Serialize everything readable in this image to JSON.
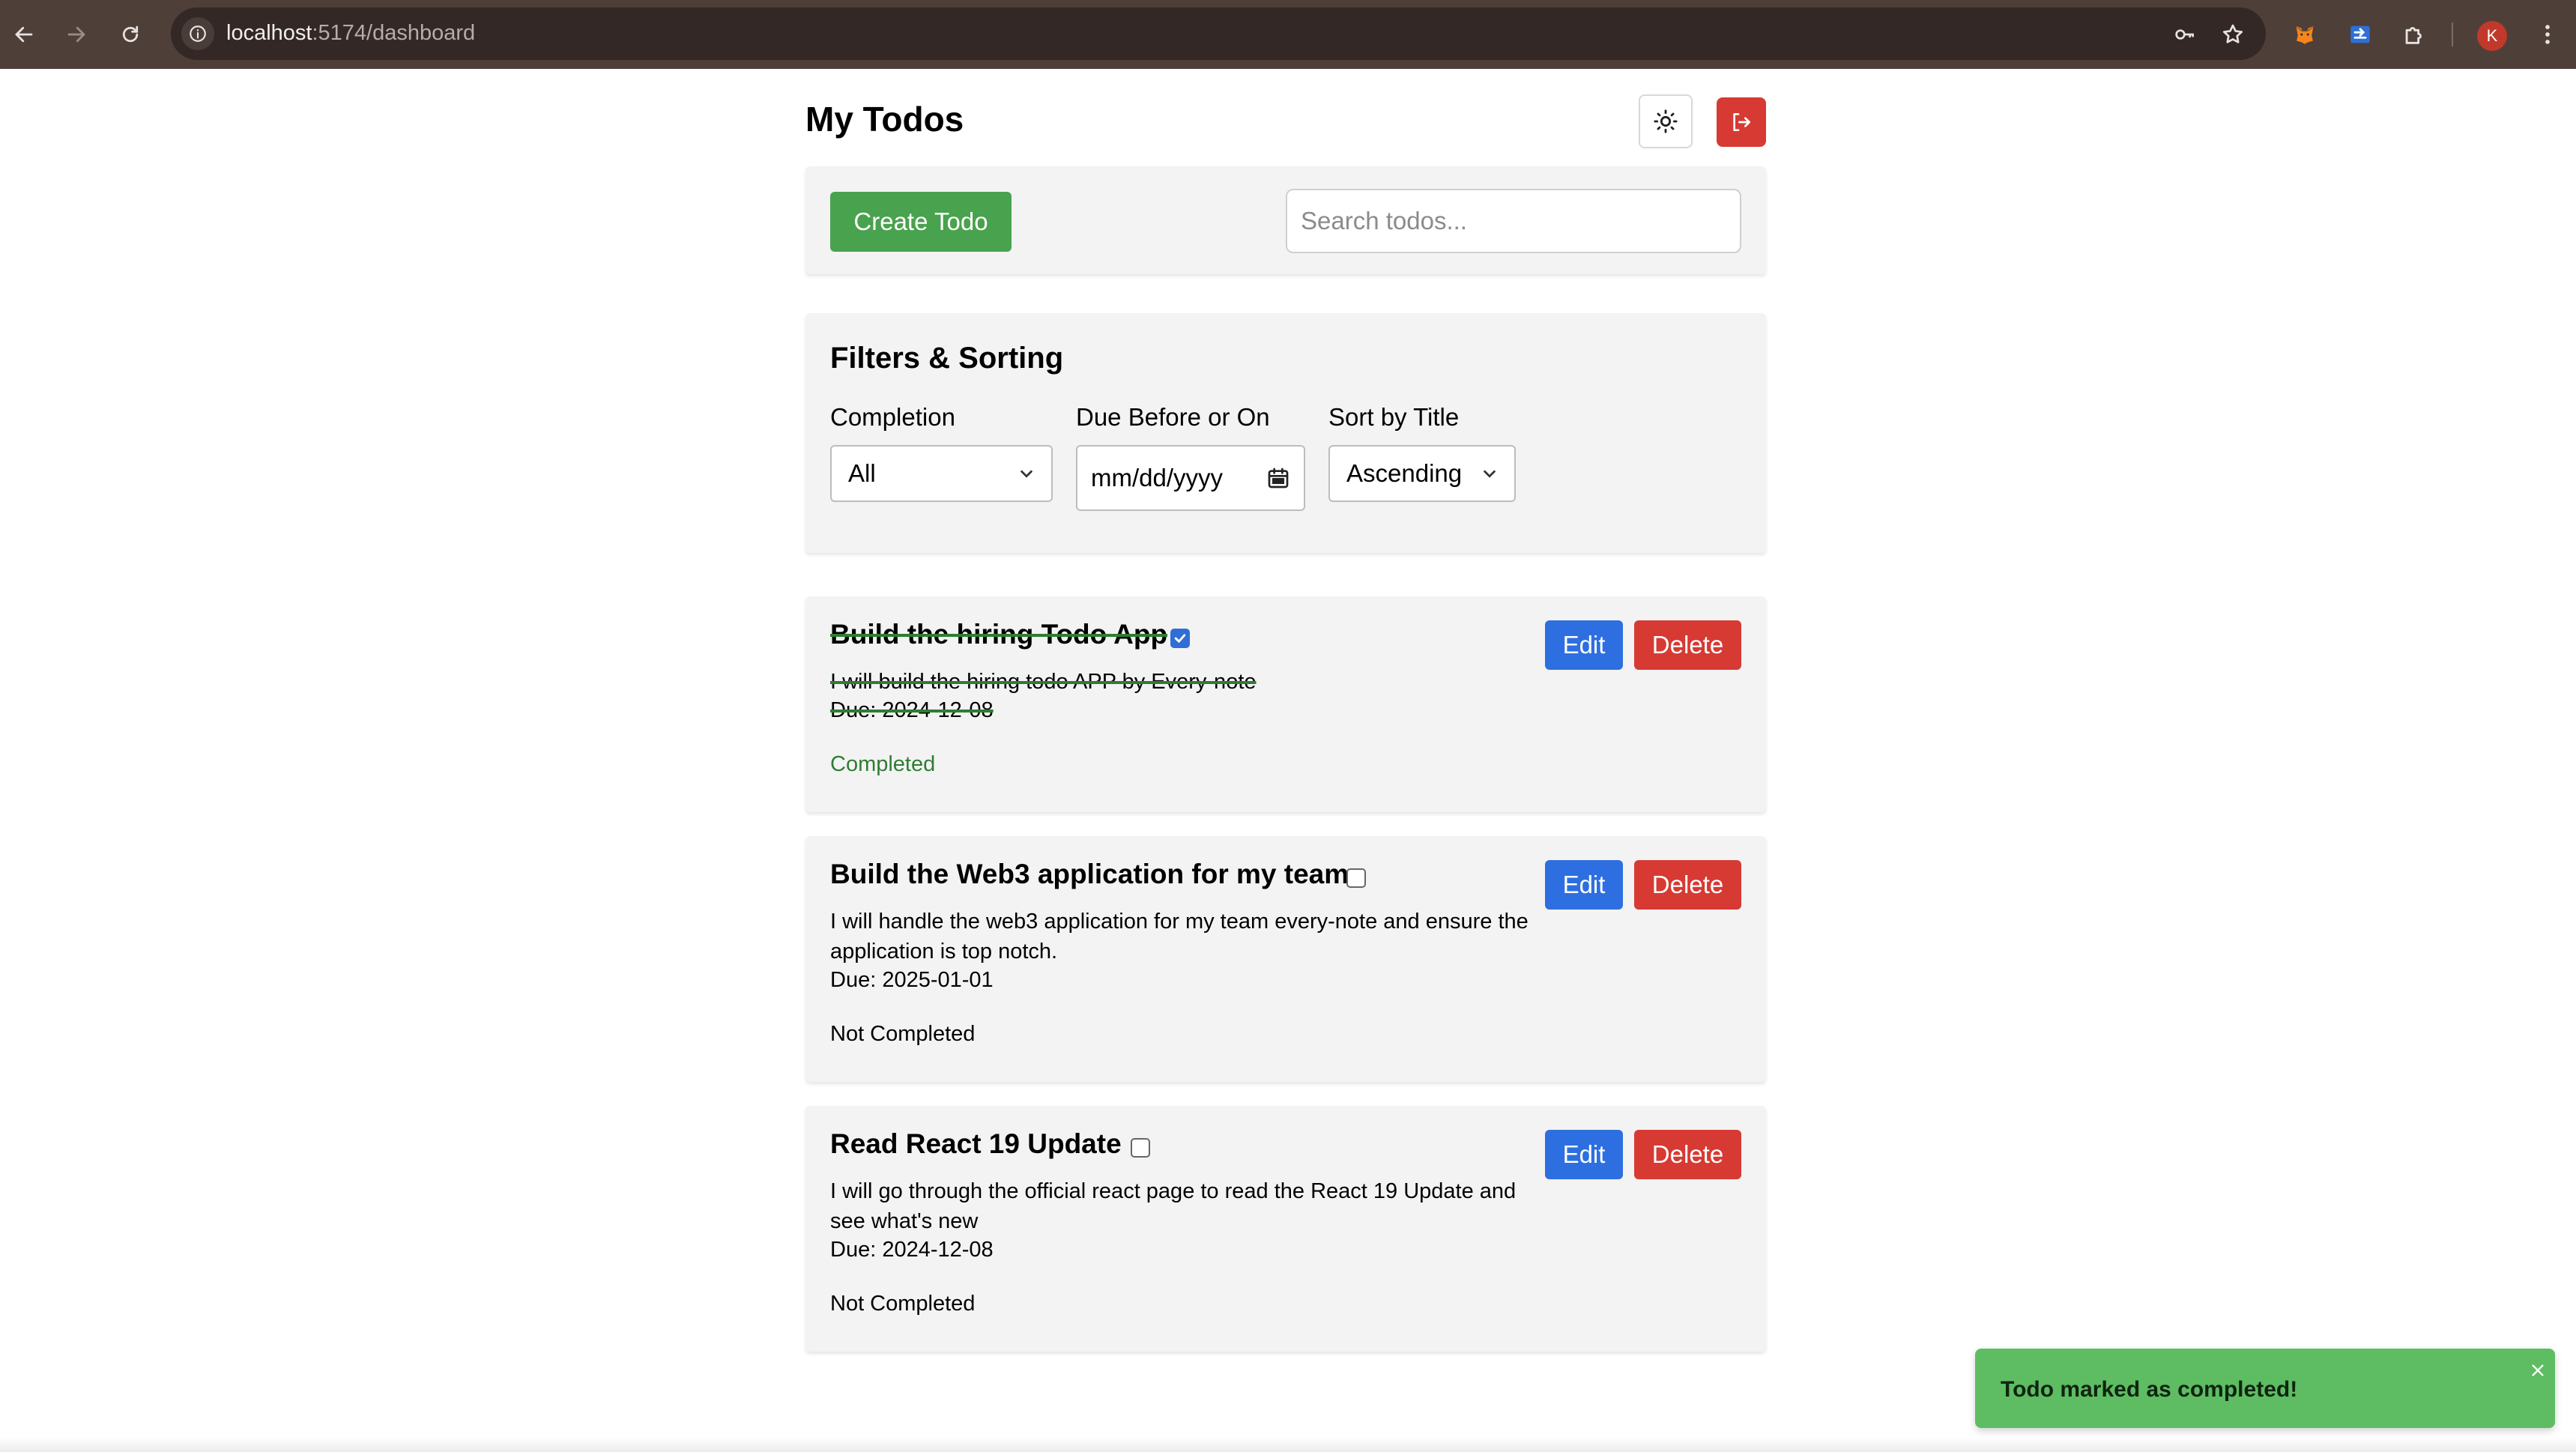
{
  "browser": {
    "url_host": "localhost",
    "url_path": ":5174/dashboard",
    "profile_initial": "K",
    "icons": [
      "back-icon",
      "forward-icon",
      "reload-icon",
      "site-info-icon",
      "password-key-icon",
      "bookmark-star-icon",
      "metamask-extension-icon",
      "cast-extension-icon",
      "extensions-puzzle-icon",
      "kebab-menu-icon"
    ]
  },
  "header": {
    "title": "My Todos",
    "theme_icon": "sun-icon",
    "logout_icon": "logout-icon"
  },
  "toolbar": {
    "create_label": "Create Todo",
    "search_placeholder": "Search todos..."
  },
  "filters": {
    "title": "Filters & Sorting",
    "completion_label": "Completion",
    "completion_value": "All",
    "due_label": "Due Before or On",
    "due_placeholder": "mm/dd/yyyy",
    "sort_label": "Sort by Title",
    "sort_value": "Ascending"
  },
  "todos": [
    {
      "title": "Build the hiring Todo App",
      "description": "I will build the hiring todo APP by Every-note",
      "due": "Due: 2024-12-08",
      "status": "Completed",
      "completed": true,
      "edit_label": "Edit",
      "delete_label": "Delete"
    },
    {
      "title": "Build the Web3 application for my team",
      "description": "I will handle the web3 application for my team every-note and ensure the application is top notch.",
      "due": "Due: 2025-01-01",
      "status": "Not Completed",
      "completed": false,
      "edit_label": "Edit",
      "delete_label": "Delete"
    },
    {
      "title": "Read React 19 Update",
      "description": "I will go through the official react page to read the React 19 Update and see what's new",
      "due": "Due: 2024-12-08",
      "status": "Not Completed",
      "completed": false,
      "edit_label": "Edit",
      "delete_label": "Delete"
    }
  ],
  "toast": {
    "message": "Todo marked as completed!"
  },
  "colors": {
    "create_green": "#49a24d",
    "edit_blue": "#2d6fe0",
    "delete_red": "#d63a33",
    "completed_green": "#2e7d32",
    "toast_green": "#5ebd62",
    "chrome_brown": "#4e3f39"
  }
}
